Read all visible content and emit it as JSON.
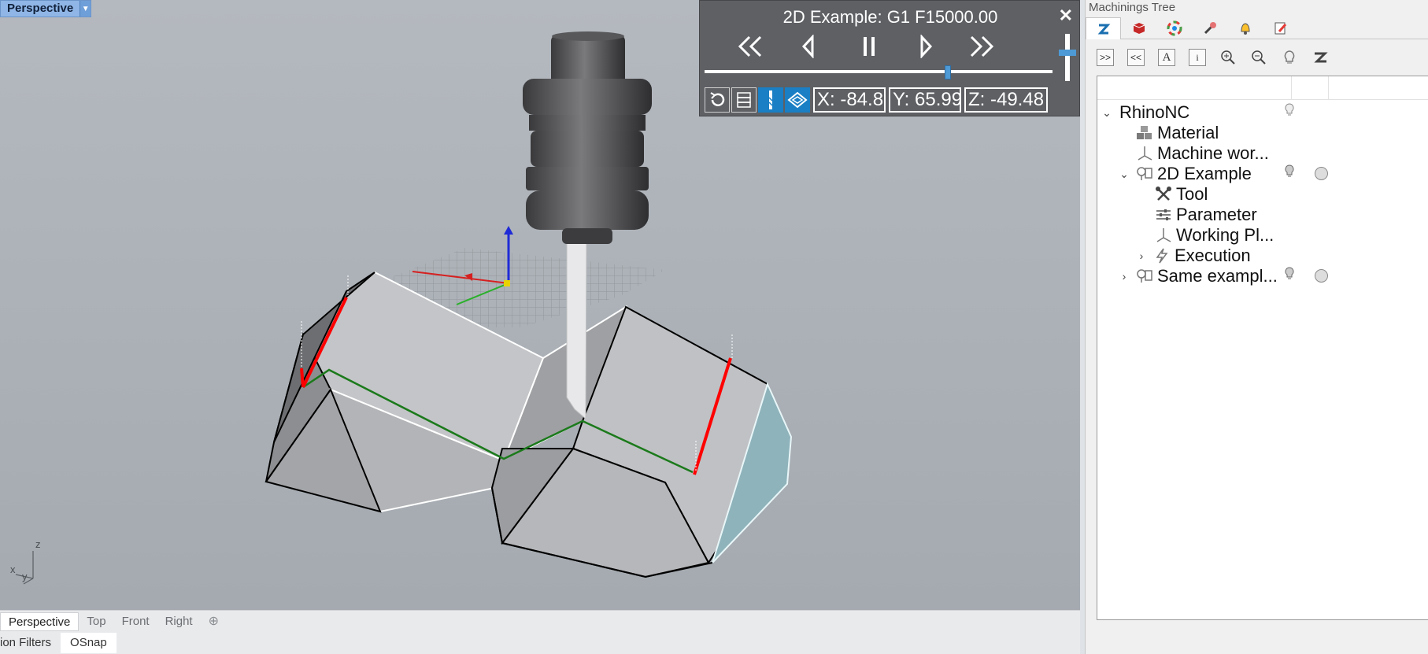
{
  "viewport": {
    "label": "Perspective",
    "axis_labels": {
      "x": "x",
      "y": "y",
      "z": "z"
    }
  },
  "simulation": {
    "title": "2D Example: G1 F15000.00",
    "progress": 0.7,
    "speed": 0.6,
    "x": "X: -84.85",
    "y": "Y: 65.999",
    "z": "Z: -49.48"
  },
  "view_tabs": [
    "Perspective",
    "Top",
    "Front",
    "Right"
  ],
  "view_tab_add": "⊕",
  "status": {
    "filters": "ion Filters",
    "osnap": "OSnap"
  },
  "panel": {
    "title": "Machinings Tree",
    "tabs": [
      "rhinonc-logo-icon",
      "material-icon",
      "color-wheel-icon",
      "tool-icon",
      "bell-icon",
      "edit-icon"
    ],
    "toolbar": [
      ">>",
      "<<",
      "A",
      "i"
    ],
    "tree": {
      "root": "RhinoNC",
      "material": "Material",
      "machine": "Machine wor...",
      "example": "2D Example",
      "tool": "Tool",
      "parameter": "Parameter",
      "working": "Working Pl...",
      "execution": "Execution",
      "same": "Same exampl..."
    }
  },
  "colors": {
    "accent": "#1a7fc4",
    "toolpath": "#1b7a1b",
    "approach": "#ff0000",
    "panel_bg": "#5e6064"
  }
}
